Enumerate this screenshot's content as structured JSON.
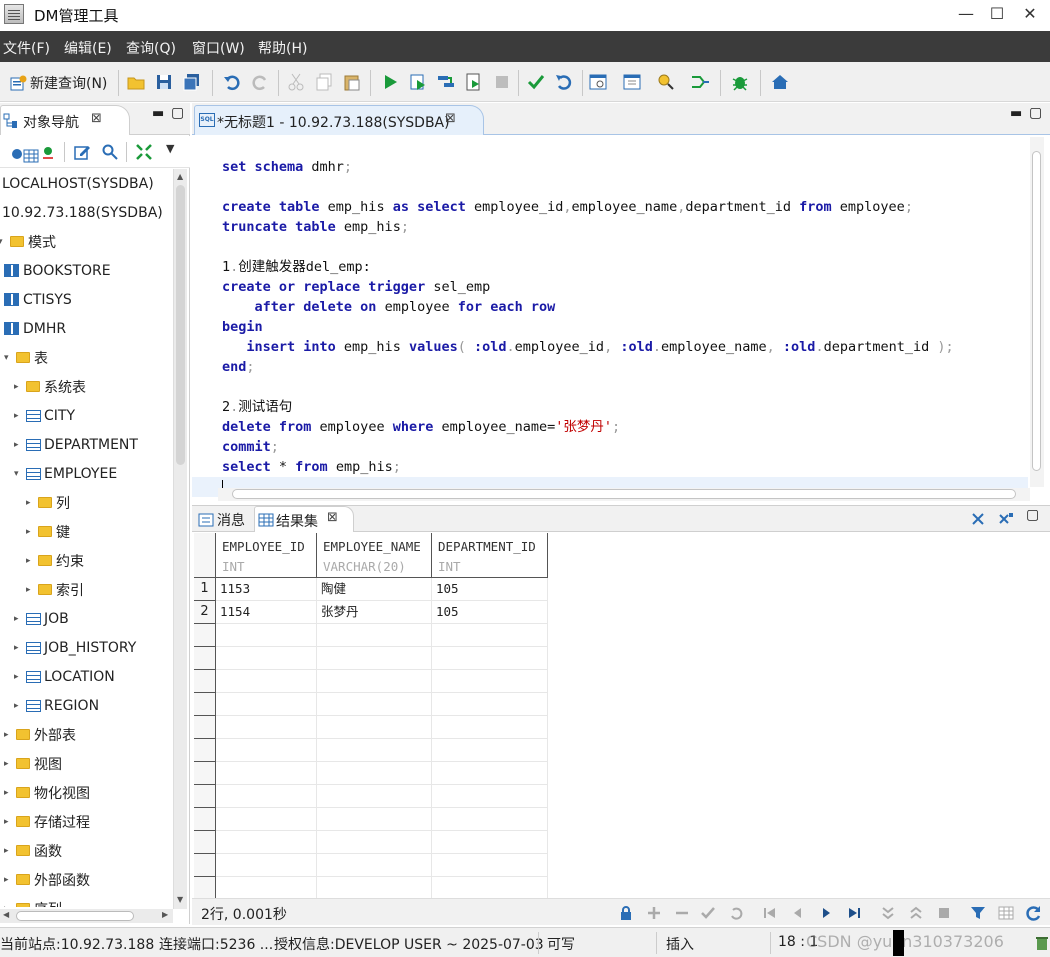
{
  "window": {
    "title": "DM管理工具",
    "minimize": "—",
    "maximize": "☐",
    "close": "✕"
  },
  "menu": [
    "文件(F)",
    "编辑(E)",
    "查询(Q)",
    "窗口(W)",
    "帮助(H)"
  ],
  "toolbar": {
    "new_query_label": "新建查询(N)"
  },
  "nav": {
    "tab_label": "对象导航",
    "tree": [
      {
        "label": "LOCALHOST(SYSDBA)",
        "icon": "none",
        "indent": 0,
        "arrow": ""
      },
      {
        "label": "10.92.73.188(SYSDBA)",
        "icon": "none",
        "indent": 0,
        "arrow": ""
      },
      {
        "label": "模式",
        "icon": "folder-icon",
        "indent": 0,
        "arrow": "▾"
      },
      {
        "label": "BOOKSTORE",
        "icon": "schema-icon",
        "indent": 1,
        "arrow": ""
      },
      {
        "label": "CTISYS",
        "icon": "schema-icon",
        "indent": 1,
        "arrow": ""
      },
      {
        "label": "DMHR",
        "icon": "schema-icon",
        "indent": 1,
        "arrow": ""
      },
      {
        "label": "表",
        "icon": "folder-icon",
        "indent": 1,
        "arrow": "▾"
      },
      {
        "label": "系统表",
        "icon": "folder-icon",
        "indent": 2,
        "arrow": "▸"
      },
      {
        "label": "CITY",
        "icon": "table-icon",
        "indent": 2,
        "arrow": "▸"
      },
      {
        "label": "DEPARTMENT",
        "icon": "table-icon",
        "indent": 2,
        "arrow": "▸"
      },
      {
        "label": "EMPLOYEE",
        "icon": "table-icon",
        "indent": 2,
        "arrow": "▾"
      },
      {
        "label": "列",
        "icon": "folder-icon",
        "indent": 3,
        "arrow": "▸"
      },
      {
        "label": "键",
        "icon": "folder-icon",
        "indent": 3,
        "arrow": "▸"
      },
      {
        "label": "约束",
        "icon": "folder-icon",
        "indent": 3,
        "arrow": "▸"
      },
      {
        "label": "索引",
        "icon": "folder-icon",
        "indent": 3,
        "arrow": "▸"
      },
      {
        "label": "JOB",
        "icon": "table-icon",
        "indent": 2,
        "arrow": "▸"
      },
      {
        "label": "JOB_HISTORY",
        "icon": "table-icon",
        "indent": 2,
        "arrow": "▸"
      },
      {
        "label": "LOCATION",
        "icon": "table-icon",
        "indent": 2,
        "arrow": "▸"
      },
      {
        "label": "REGION",
        "icon": "table-icon",
        "indent": 2,
        "arrow": "▸"
      },
      {
        "label": "外部表",
        "icon": "folder-icon",
        "indent": 1,
        "arrow": "▸"
      },
      {
        "label": "视图",
        "icon": "folder-icon",
        "indent": 1,
        "arrow": "▸"
      },
      {
        "label": "物化视图",
        "icon": "folder-icon",
        "indent": 1,
        "arrow": "▸"
      },
      {
        "label": "存储过程",
        "icon": "folder-icon",
        "indent": 1,
        "arrow": "▸"
      },
      {
        "label": "函数",
        "icon": "folder-icon",
        "indent": 1,
        "arrow": "▸"
      },
      {
        "label": "外部函数",
        "icon": "folder-icon",
        "indent": 1,
        "arrow": "▸"
      },
      {
        "label": "序列",
        "icon": "folder-icon",
        "indent": 1,
        "arrow": "▸"
      }
    ]
  },
  "editor": {
    "tab_label": "*无标题1 - 10.92.73.188(SYSDBA)",
    "tab_badge": "SQL",
    "lines": [
      [
        {
          "t": "set schema ",
          "c": "kw"
        },
        {
          "t": "dmhr",
          "c": ""
        },
        {
          "t": ";",
          "c": "punc"
        }
      ],
      [],
      [
        {
          "t": "create table ",
          "c": "kw"
        },
        {
          "t": "emp_his ",
          "c": ""
        },
        {
          "t": "as select ",
          "c": "kw"
        },
        {
          "t": "employee_id",
          "c": ""
        },
        {
          "t": ",",
          "c": "punc"
        },
        {
          "t": "employee_name",
          "c": ""
        },
        {
          "t": ",",
          "c": "punc"
        },
        {
          "t": "department_id ",
          "c": ""
        },
        {
          "t": "from ",
          "c": "kw"
        },
        {
          "t": "employee",
          "c": ""
        },
        {
          "t": ";",
          "c": "punc"
        }
      ],
      [
        {
          "t": "truncate table ",
          "c": "kw"
        },
        {
          "t": "emp_his",
          "c": ""
        },
        {
          "t": ";",
          "c": "punc"
        }
      ],
      [],
      [
        {
          "t": "1",
          "c": ""
        },
        {
          "t": ".",
          "c": "punc"
        },
        {
          "t": "创建触发器del_emp:",
          "c": "cmt"
        }
      ],
      [
        {
          "t": "create or replace trigger ",
          "c": "kw"
        },
        {
          "t": "sel_emp",
          "c": ""
        }
      ],
      [
        {
          "t": "    after delete on ",
          "c": "kw"
        },
        {
          "t": "employee ",
          "c": ""
        },
        {
          "t": "for each row",
          "c": "kw"
        }
      ],
      [
        {
          "t": "begin",
          "c": "kw"
        }
      ],
      [
        {
          "t": "   insert into ",
          "c": "kw"
        },
        {
          "t": "emp_his ",
          "c": ""
        },
        {
          "t": "values",
          "c": "kw"
        },
        {
          "t": "( ",
          "c": "punc"
        },
        {
          "t": ":old",
          "c": "kw"
        },
        {
          "t": ".",
          "c": "punc"
        },
        {
          "t": "employee_id",
          "c": ""
        },
        {
          "t": ", ",
          "c": "punc"
        },
        {
          "t": ":old",
          "c": "kw"
        },
        {
          "t": ".",
          "c": "punc"
        },
        {
          "t": "employee_name",
          "c": ""
        },
        {
          "t": ", ",
          "c": "punc"
        },
        {
          "t": ":old",
          "c": "kw"
        },
        {
          "t": ".",
          "c": "punc"
        },
        {
          "t": "department_id ",
          "c": ""
        },
        {
          "t": ");",
          "c": "punc"
        }
      ],
      [
        {
          "t": "end",
          "c": "kw"
        },
        {
          "t": ";",
          "c": "punc"
        }
      ],
      [],
      [
        {
          "t": "2",
          "c": ""
        },
        {
          "t": ".",
          "c": "punc"
        },
        {
          "t": "测试语句",
          "c": "cmt"
        }
      ],
      [
        {
          "t": "delete from ",
          "c": "kw"
        },
        {
          "t": "employee ",
          "c": ""
        },
        {
          "t": "where ",
          "c": "kw"
        },
        {
          "t": "employee_name=",
          "c": ""
        },
        {
          "t": "'张梦丹'",
          "c": "str"
        },
        {
          "t": ";",
          "c": "punc"
        }
      ],
      [
        {
          "t": "commit",
          "c": "kw"
        },
        {
          "t": ";",
          "c": "punc"
        }
      ],
      [
        {
          "t": "select ",
          "c": "kw"
        },
        {
          "t": "* ",
          "c": ""
        },
        {
          "t": "from ",
          "c": "kw"
        },
        {
          "t": "emp_his",
          "c": ""
        },
        {
          "t": ";",
          "c": "punc"
        }
      ],
      []
    ]
  },
  "results": {
    "messages_tab": "消息",
    "resultset_tab": "结果集",
    "columns": [
      {
        "name": "EMPLOYEE_ID",
        "type": "INT"
      },
      {
        "name": "EMPLOYEE_NAME",
        "type": "VARCHAR(20)"
      },
      {
        "name": "DEPARTMENT_ID",
        "type": "INT"
      }
    ],
    "rows": [
      {
        "n": "1",
        "cells": [
          "1153",
          "陶健",
          "105"
        ]
      },
      {
        "n": "2",
        "cells": [
          "1154",
          "张梦丹",
          "105"
        ]
      }
    ],
    "summary": "2行, 0.001秒"
  },
  "status": {
    "site": "当前站点:10.92.73.188",
    "port": "连接端口:5236 ...",
    "license": "授权信息:DEVELOP USER ~ 2025-07-03",
    "mode": "可写",
    "insert": "插入",
    "position": "18 : 1",
    "watermark": "CSDN @yuan310373206"
  }
}
